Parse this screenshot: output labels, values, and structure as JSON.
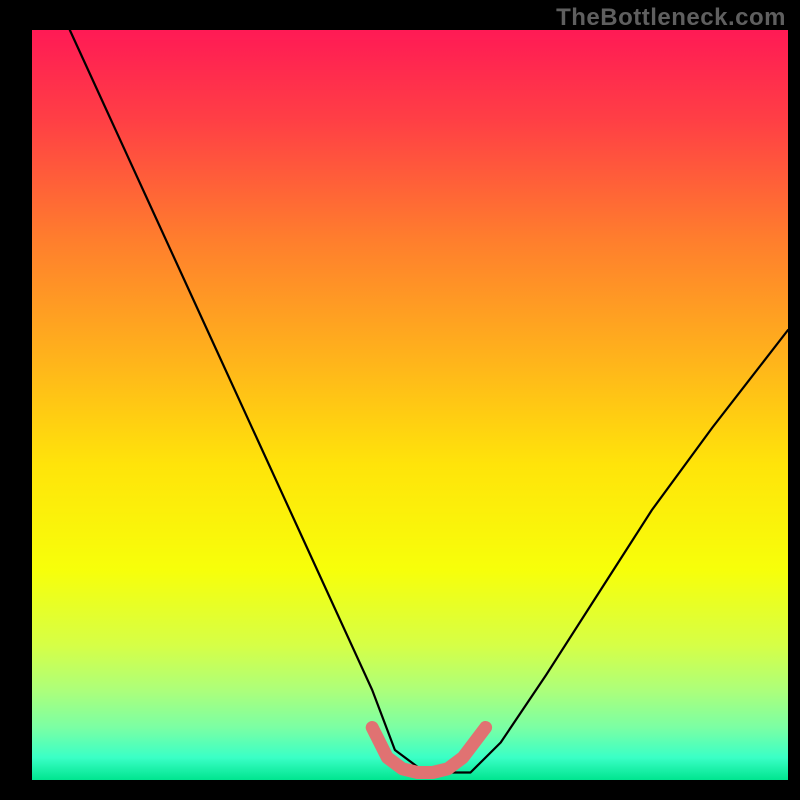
{
  "watermark": "TheBottleneck.com",
  "chart_data": {
    "type": "line",
    "title": "",
    "xlabel": "",
    "ylabel": "",
    "xlim": [
      0,
      100
    ],
    "ylim": [
      0,
      100
    ],
    "grid": false,
    "legend": false,
    "axes_visible": false,
    "background_gradient": {
      "stops": [
        {
          "pct": 0,
          "color": "#ff1a55"
        },
        {
          "pct": 12,
          "color": "#ff3f45"
        },
        {
          "pct": 28,
          "color": "#ff7e2d"
        },
        {
          "pct": 45,
          "color": "#ffb71a"
        },
        {
          "pct": 58,
          "color": "#ffe40a"
        },
        {
          "pct": 72,
          "color": "#f7ff0a"
        },
        {
          "pct": 82,
          "color": "#d6ff46"
        },
        {
          "pct": 88,
          "color": "#adff7a"
        },
        {
          "pct": 93,
          "color": "#7bffa4"
        },
        {
          "pct": 97,
          "color": "#3affc6"
        },
        {
          "pct": 100,
          "color": "#00e58f"
        }
      ]
    },
    "series": [
      {
        "name": "bottleneck-curve",
        "x": [
          5,
          10,
          15,
          20,
          25,
          30,
          35,
          40,
          45,
          48,
          52,
          55,
          58,
          62,
          68,
          75,
          82,
          90,
          100
        ],
        "y": [
          100,
          89,
          78,
          67,
          56,
          45,
          34,
          23,
          12,
          4,
          1,
          1,
          1,
          5,
          14,
          25,
          36,
          47,
          60
        ],
        "color": "#000000",
        "width": 2.2
      }
    ],
    "annotations": [
      {
        "name": "trough-highlight",
        "type": "path-stroke",
        "x": [
          45,
          47,
          49,
          51,
          53,
          55,
          57,
          60
        ],
        "y": [
          7,
          3,
          1.5,
          1,
          1,
          1.5,
          3,
          7
        ],
        "color": "#e07272",
        "width": 13
      }
    ]
  }
}
